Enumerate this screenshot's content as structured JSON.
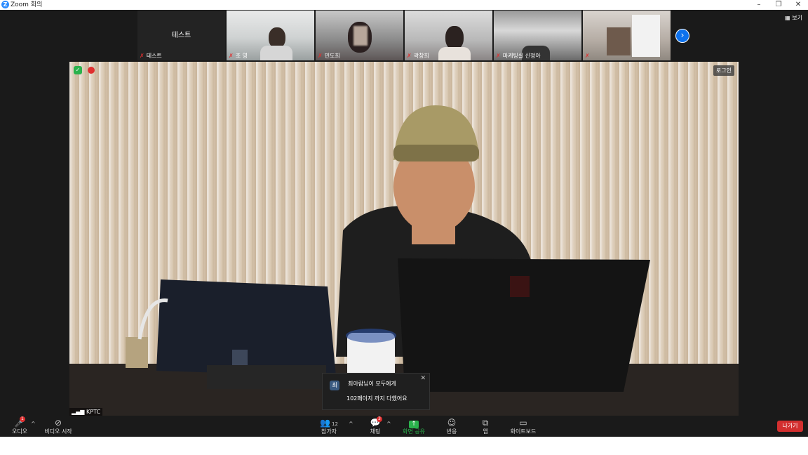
{
  "window": {
    "title": "Zoom 회의",
    "minimize": "–",
    "restore": "❐",
    "close": "✕"
  },
  "view_button": {
    "label": "보기"
  },
  "participants_strip": {
    "tiles": [
      {
        "label": "테스트",
        "name": "테스트"
      },
      {
        "name": "조 영"
      },
      {
        "name": "민도희"
      },
      {
        "name": "곽창희"
      },
      {
        "name": "마케팅실 신정아"
      },
      {
        "name": ""
      }
    ],
    "next_page_icon": "chevron-right-icon"
  },
  "main_video": {
    "login_label": "로그인",
    "network_label": "KPTC"
  },
  "chat_popup": {
    "avatar_letter": "최",
    "sender": "최아람님이 모두에게",
    "message": "102페이지 까지 다했어요"
  },
  "toolbar": {
    "audio": {
      "label": "오디오",
      "badge": "1"
    },
    "video": {
      "label": "비디오 시작"
    },
    "participants": {
      "label": "참가자",
      "count": "12"
    },
    "chat": {
      "label": "채팅",
      "badge": "3"
    },
    "share": {
      "label": "화면 공유"
    },
    "reactions": {
      "label": "반응"
    },
    "apps": {
      "label": "앱"
    },
    "whiteboard": {
      "label": "화이트보드"
    },
    "leave": {
      "label": "나가기"
    }
  },
  "colors": {
    "zoom_blue": "#2D8CFF",
    "share_green": "#2BB24C",
    "leave_red": "#D32F2F",
    "muted_red": "#E02F2F"
  }
}
